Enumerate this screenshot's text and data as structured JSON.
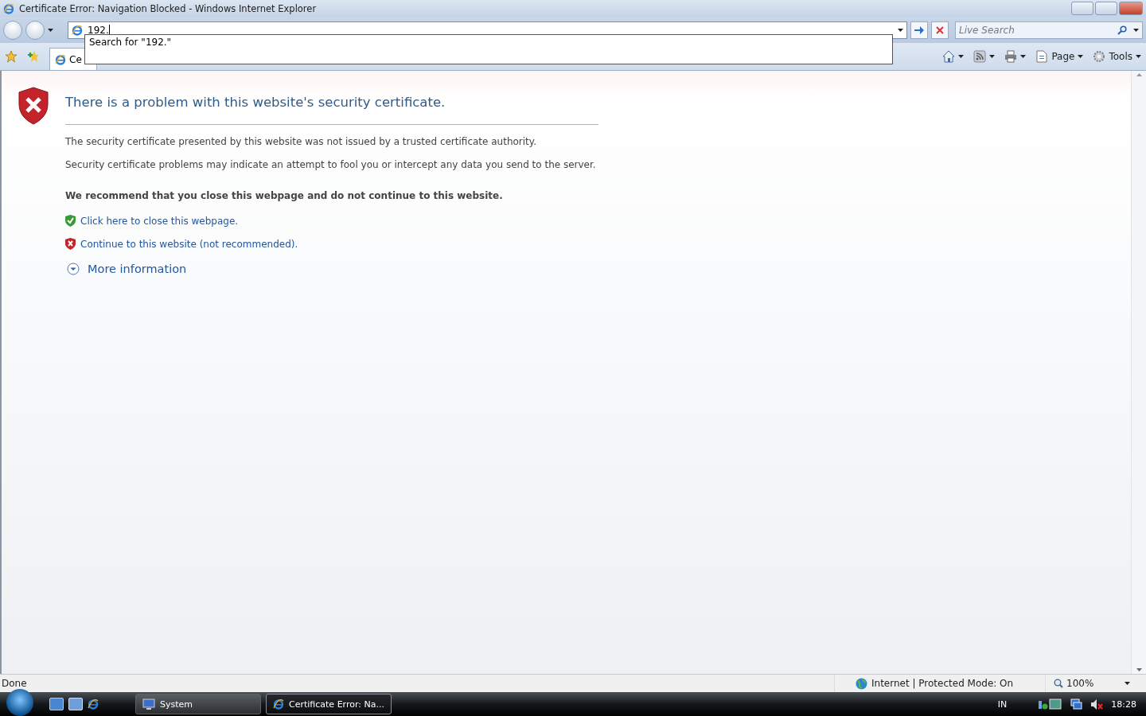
{
  "window": {
    "title": "Certificate Error: Navigation Blocked - Windows Internet Explorer"
  },
  "address_bar": {
    "value": "192."
  },
  "autocomplete": {
    "suggestion": "Search for \"192.\""
  },
  "search": {
    "placeholder": "Live Search"
  },
  "tab": {
    "label": "Ce",
    "selected": true
  },
  "toolbar": {
    "items": [
      {
        "kind": "home"
      },
      {
        "kind": "feeds"
      },
      {
        "kind": "print"
      },
      {
        "kind": "page",
        "label": "Page"
      },
      {
        "kind": "tools",
        "label": "Tools"
      }
    ]
  },
  "page": {
    "heading": "There is a problem with this website's security certificate.",
    "paragraphs": [
      "The security certificate presented by this website was not issued by a trusted certificate authority.",
      "Security certificate problems may indicate an attempt to fool you or intercept any data you send to the server."
    ],
    "recommendation": "We recommend that you close this webpage and do not continue to this website.",
    "links": [
      {
        "kind": "close",
        "label": "Click here to close this webpage."
      },
      {
        "kind": "continue",
        "label": "Continue to this website (not recommended)."
      }
    ],
    "more_information": {
      "label": "More information",
      "expanded": false
    }
  },
  "status_bar": {
    "status": "Done",
    "zone": "Internet | Protected Mode: On",
    "zoom": "100%"
  },
  "taskbar": {
    "buttons": [
      {
        "label": "System",
        "kind": "system",
        "selected": false
      },
      {
        "label": "Certificate Error: Na...",
        "kind": "ie",
        "selected": true
      }
    ],
    "language": "IN",
    "clock": "18:28"
  }
}
